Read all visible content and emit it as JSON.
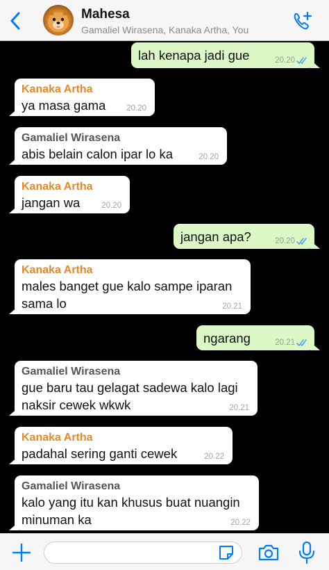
{
  "header": {
    "title": "Mahesa",
    "subtitle": "Gamaliel Wirasena, Kanaka Artha, You"
  },
  "messages": [
    {
      "dir": "out",
      "text": "lah kenapa jadi gue",
      "time": "20.20"
    },
    {
      "dir": "in",
      "sender": "Kanaka Artha",
      "text": "ya masa gama",
      "time": "20.20"
    },
    {
      "dir": "in",
      "sender": "Gamaliel Wirasena",
      "text": "abis belain calon ipar lo ka",
      "time": "20.20"
    },
    {
      "dir": "in",
      "sender": "Kanaka Artha",
      "text": "jangan wa",
      "time": "20.20"
    },
    {
      "dir": "out",
      "text": "jangan apa?",
      "time": "20.20"
    },
    {
      "dir": "in",
      "sender": "Kanaka Artha",
      "text": "males banget gue kalo sampe iparan sama lo",
      "time": "20.21"
    },
    {
      "dir": "out",
      "text": "ngarang",
      "time": "20.21"
    },
    {
      "dir": "in",
      "sender": "Gamaliel Wirasena",
      "text": "gue baru tau gelagat sadewa kalo lagi naksir cewek wkwk",
      "time": "20.21"
    },
    {
      "dir": "in",
      "sender": "Kanaka Artha",
      "text": "padahal sering ganti cewek",
      "time": "20.22"
    },
    {
      "dir": "in",
      "sender": "Gamaliel Wirasena",
      "text": "kalo yang itu kan khusus buat nuangin minuman ka",
      "time": "20.22"
    }
  ],
  "colors": {
    "chat_background": "#000000",
    "incoming_bubble": "#ffffff",
    "outgoing_bubble": "#dcf8c6",
    "accent": "#007aff",
    "sender_kanaka": "#e08a2b",
    "sender_gamaliel": "#555555",
    "read_ticks": "#4fa6e8"
  },
  "icons": {
    "back": "chevron-left-icon",
    "call": "add-call-icon",
    "add": "plus-icon",
    "sticker": "sticker-icon",
    "camera": "camera-icon",
    "mic": "microphone-icon",
    "read": "double-check-icon"
  },
  "input": {
    "value": "",
    "placeholder": ""
  }
}
